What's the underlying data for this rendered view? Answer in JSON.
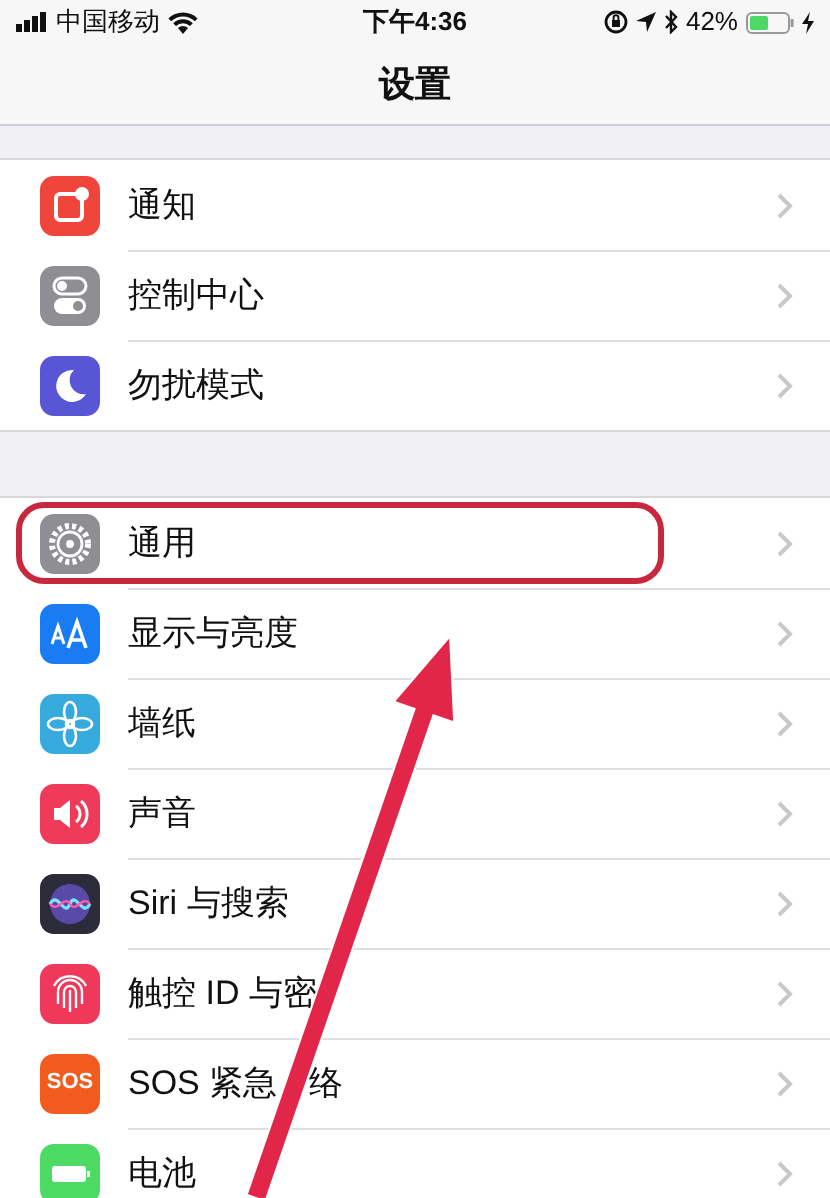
{
  "status_bar": {
    "carrier": "中国移动",
    "time": "下午4:36",
    "battery": "42%"
  },
  "nav": {
    "title": "设置"
  },
  "groups": [
    {
      "rows": [
        {
          "label": "通知",
          "kind": "notifications",
          "color": "#f0453a",
          "highlighted": false
        },
        {
          "label": "控制中心",
          "kind": "toggles",
          "color": "#8e8e93",
          "highlighted": false
        },
        {
          "label": "勿扰模式",
          "kind": "moon",
          "color": "#5856d6",
          "highlighted": false
        }
      ]
    },
    {
      "rows": [
        {
          "label": "通用",
          "kind": "gear",
          "color": "#8e8e93",
          "highlighted": true
        },
        {
          "label": "显示与亮度",
          "kind": "text",
          "color": "#1a7cf5",
          "highlighted": false
        },
        {
          "label": "墙纸",
          "kind": "flower",
          "color": "#36aadc",
          "highlighted": false
        },
        {
          "label": "声音",
          "kind": "speaker",
          "color": "#f03a5a",
          "highlighted": false
        },
        {
          "label": "Siri 与搜索",
          "kind": "siri",
          "color": "#2b2b3a",
          "highlighted": false
        },
        {
          "label": "触控 ID 与密",
          "kind": "fingerprint",
          "color": "#f0385a",
          "highlighted": false
        },
        {
          "label": "SOS 紧急",
          "label_tail": "络",
          "kind": "sos",
          "icon_text": "SOS",
          "color": "#f25a1e",
          "highlighted": false
        },
        {
          "label": "电池",
          "kind": "battery",
          "color": "#4cd964",
          "highlighted": false
        }
      ]
    }
  ]
}
